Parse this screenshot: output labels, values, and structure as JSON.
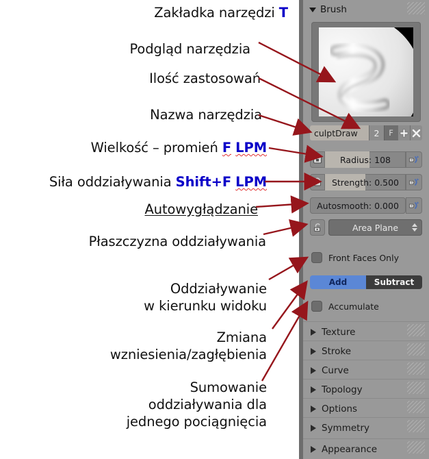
{
  "annotations": [
    {
      "id": "tab-tools",
      "lines": [
        {
          "text": "Zakładka narzędzi ",
          "style": "plain"
        },
        {
          "text": "T",
          "style": "kbd"
        }
      ]
    },
    {
      "id": "tool-preview",
      "lines": [
        {
          "text": "Podgląd narzędzia",
          "style": "plain"
        }
      ]
    },
    {
      "id": "use-count",
      "lines": [
        {
          "text": "Ilość zastosowań",
          "style": "plain"
        }
      ]
    },
    {
      "id": "tool-name",
      "lines": [
        {
          "text": "Nazwa narzędzia",
          "style": "plain"
        }
      ]
    },
    {
      "id": "size-radius",
      "lines": [
        {
          "text": "Wielkość – promień ",
          "style": "plain"
        },
        {
          "text": "F",
          "style": "kbd-sq"
        },
        {
          "text": " ",
          "style": "plain"
        },
        {
          "text": "LPM",
          "style": "kbd-sq"
        }
      ]
    },
    {
      "id": "strength",
      "lines": [
        {
          "text": "Siła oddziaływania ",
          "style": "plain"
        },
        {
          "text": "Shift+F",
          "style": "kbd"
        },
        {
          "text": " ",
          "style": "plain"
        },
        {
          "text": "LPM",
          "style": "kbd-sq"
        }
      ]
    },
    {
      "id": "autosmooth",
      "lines": [
        {
          "text": "Autowygłądzanie",
          "style": "sq"
        }
      ]
    },
    {
      "id": "area-plane",
      "lines": [
        {
          "text": "Płaszczyzna oddziaływania",
          "style": "plain"
        }
      ]
    },
    {
      "id": "front-faces",
      "lines": [
        {
          "text": "Oddziaływanie\nw kierunku widoku",
          "style": "plain"
        }
      ]
    },
    {
      "id": "add-subtract",
      "lines": [
        {
          "text": "Zmiana\nwzniesienia/zagłębienia",
          "style": "plain"
        }
      ]
    },
    {
      "id": "accumulate",
      "lines": [
        {
          "text": "Sumowanie\noddziaływania dla\njednego pociągnięcia",
          "style": "plain"
        }
      ]
    }
  ],
  "panel": {
    "brush": {
      "header_label": "Brush",
      "name": "culptDraw",
      "count": "2",
      "fake_user_label": "F",
      "new_label": "+",
      "unlink_label": "✕"
    },
    "sliders": [
      {
        "id": "radius",
        "label": "Radius: 108",
        "fill_pct": 55
      },
      {
        "id": "strength",
        "label": "Strength: 0.500",
        "fill_pct": 50
      },
      {
        "id": "autosmooth",
        "label": "Autosmooth: 0.000",
        "fill_pct": 0
      }
    ],
    "plane": {
      "label": "Area Plane"
    },
    "checkboxes": [
      {
        "id": "front-faces-only",
        "label": "Front Faces Only",
        "checked": false
      },
      {
        "id": "accumulate",
        "label": "Accumulate",
        "checked": false
      }
    ],
    "direction": {
      "add_label": "Add",
      "subtract_label": "Subtract",
      "selected": "Add"
    },
    "collapsed_panels": [
      {
        "label": "Texture"
      },
      {
        "label": "Stroke"
      },
      {
        "label": "Curve"
      },
      {
        "label": "Topology"
      },
      {
        "label": "Options"
      },
      {
        "label": "Symmetry"
      },
      {
        "label": "Appearance"
      }
    ]
  },
  "colors": {
    "panel_bg": "#999999",
    "accent_blue": "#5b87d6",
    "kbd_blue": "#0a00c8",
    "arrow_red": "#96161c",
    "spell_red": "#e03030"
  }
}
